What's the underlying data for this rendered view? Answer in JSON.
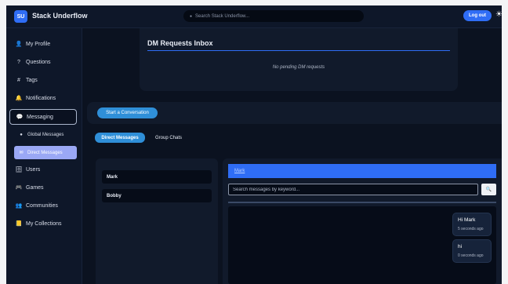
{
  "app": {
    "logo_text": "SU",
    "title": "Stack Underflow",
    "search_placeholder": "Search Stack Underflow...",
    "logout_label": "Log out",
    "theme_icon": "sun-icon"
  },
  "sidebar": {
    "items": [
      {
        "label": "My Profile",
        "icon": "user-icon",
        "glyph": "👤"
      },
      {
        "label": "Questions",
        "icon": "question-icon",
        "glyph": "?"
      },
      {
        "label": "Tags",
        "icon": "hash-icon",
        "glyph": "#"
      },
      {
        "label": "Notifications",
        "icon": "bell-icon",
        "glyph": "🔔"
      },
      {
        "label": "Messaging",
        "icon": "chat-icon",
        "glyph": "💬"
      },
      {
        "label": "Users",
        "icon": "users-icon",
        "glyph": "🗄"
      },
      {
        "label": "Games",
        "icon": "gamepad-icon",
        "glyph": "🎮"
      },
      {
        "label": "Communities",
        "icon": "community-icon",
        "glyph": "👥"
      },
      {
        "label": "My Collections",
        "icon": "notebook-icon",
        "glyph": "📒"
      }
    ],
    "sub_items": [
      {
        "label": "Global Messages",
        "icon": "globe-icon",
        "glyph": "●"
      },
      {
        "label": "Direct Messages",
        "icon": "mail-icon",
        "glyph": "✉"
      }
    ]
  },
  "dm_requests": {
    "title": "DM Requests Inbox",
    "empty_text": "No pending DM requests"
  },
  "conversation": {
    "start_label": "Start a Conversation"
  },
  "tabs": {
    "direct": "Direct Messages",
    "group": "Group Chats"
  },
  "contacts": [
    "Mark",
    "Bobby"
  ],
  "chat": {
    "header_name": "Mark",
    "search_placeholder": "Search messages by keyword...",
    "search_icon": "magnifier-icon",
    "messages": [
      {
        "text": "Hi Mark",
        "time": "5 seconds ago"
      },
      {
        "text": "hi",
        "time": "0 seconds ago"
      }
    ]
  },
  "colors": {
    "accent": "#2f6df5",
    "button": "#2f8fd8",
    "background": "#0b1220",
    "panel": "#111a2b"
  }
}
